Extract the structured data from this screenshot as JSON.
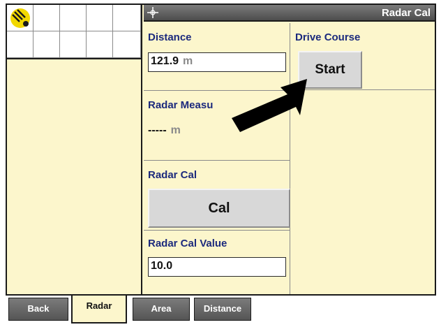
{
  "window": {
    "title": "Radar Cal"
  },
  "distance": {
    "label": "Distance",
    "value": "121.9",
    "unit": "m"
  },
  "drive_course": {
    "label": "Drive Course",
    "button_label": "Start"
  },
  "radar_measure": {
    "label": "Radar Measu",
    "value": "-----",
    "unit": "m"
  },
  "radar_cal": {
    "label": "Radar Cal",
    "button_label": "Cal"
  },
  "radar_cal_value": {
    "label": "Radar Cal Value",
    "value": "10.0"
  },
  "tabs": [
    {
      "label": "Back",
      "active": false
    },
    {
      "label": "Radar",
      "active": true
    },
    {
      "label": "Area",
      "active": false
    },
    {
      "label": "Distance",
      "active": false
    }
  ],
  "icons": {
    "logo": "gps-satellite-icon",
    "crosshair": "crosshair-icon",
    "arrow": "pointer-arrow-icon"
  },
  "colors": {
    "panel_bg": "#fcf6cc",
    "label_text": "#1c2a7d",
    "title_bar": "#5e5e5e",
    "button_bg": "#d8d8d8"
  }
}
